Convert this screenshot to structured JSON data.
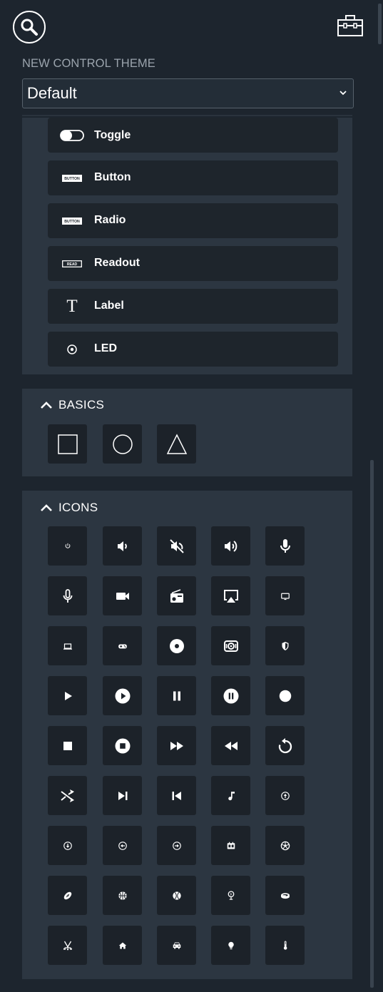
{
  "header": {
    "theme_label": "NEW CONTROL THEME",
    "theme_value": "Default"
  },
  "controls": {
    "items": [
      {
        "label": "Toggle",
        "icon": "toggle-icon"
      },
      {
        "label": "Button",
        "icon": "button-icon",
        "icon_text": "BUTTON"
      },
      {
        "label": "Radio",
        "icon": "radio-icon",
        "icon_text": "BUTTON"
      },
      {
        "label": "Readout",
        "icon": "readout-icon",
        "icon_text": "READ"
      },
      {
        "label": "Label",
        "icon": "label-icon",
        "icon_text": "T"
      },
      {
        "label": "LED",
        "icon": "led-icon"
      }
    ]
  },
  "basics": {
    "title": "BASICS",
    "shapes": [
      "square-shape",
      "circle-shape",
      "triangle-shape"
    ]
  },
  "icons": {
    "title": "ICONS",
    "items": [
      "power-icon",
      "volume-down-icon",
      "volume-mute-icon",
      "volume-up-icon",
      "microphone-icon",
      "microphone-outline-icon",
      "video-camera-icon",
      "radio-icon",
      "airplay-icon",
      "tv-icon",
      "laptop-icon",
      "gamepad-icon",
      "disc-icon",
      "speaker-icon",
      "shield-icon",
      "play-icon",
      "play-circle-icon",
      "pause-icon",
      "pause-circle-icon",
      "record-icon",
      "stop-icon",
      "stop-circle-icon",
      "fast-forward-icon",
      "rewind-icon",
      "replay-icon",
      "shuffle-icon",
      "skip-next-icon",
      "skip-previous-icon",
      "music-note-icon",
      "arrow-up-circle-icon",
      "arrow-down-circle-icon",
      "arrow-left-circle-icon",
      "arrow-right-circle-icon",
      "scoreboard-icon",
      "soccer-ball-icon",
      "football-icon",
      "basketball-icon",
      "baseball-icon",
      "golf-icon",
      "hockey-puck-icon",
      "hockey-sticks-icon",
      "home-icon",
      "car-icon",
      "lightbulb-icon",
      "thermometer-icon"
    ]
  }
}
